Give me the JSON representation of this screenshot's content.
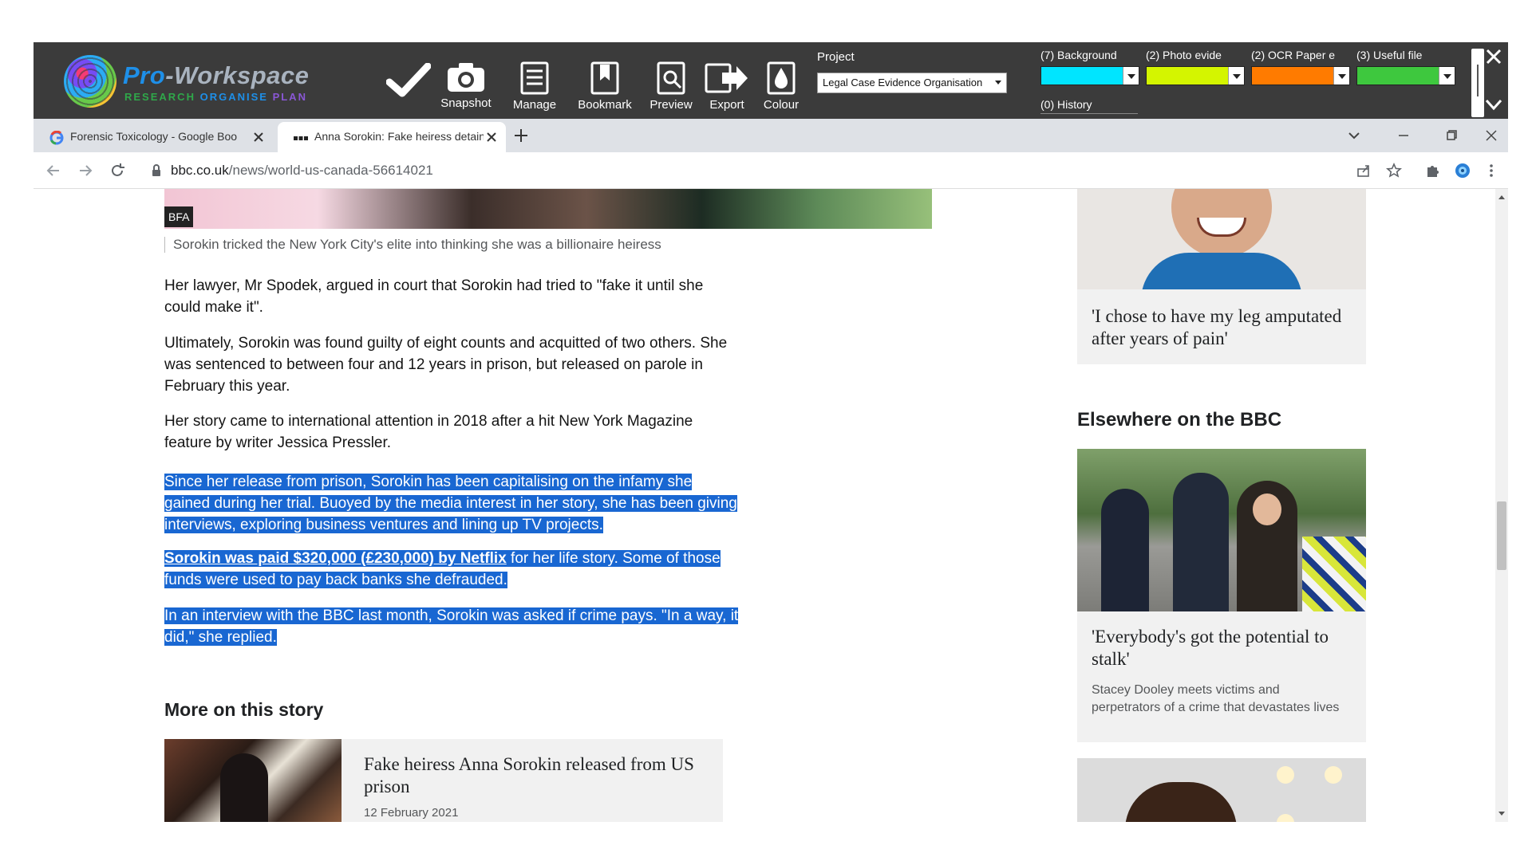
{
  "toolbar": {
    "brand": {
      "name_a": "Pro",
      "name_b": "-Workspace",
      "tag_a": "RESEARCH",
      "tag_b": "ORGANISE",
      "tag_c": "PLAN"
    },
    "buttons": [
      {
        "label": "",
        "icon": "checkmark-icon"
      },
      {
        "label": "Snapshot",
        "icon": "camera-icon"
      },
      {
        "label": "Manage",
        "icon": "document-list-icon"
      },
      {
        "label": "Bookmark",
        "icon": "bookmark-icon"
      },
      {
        "label": "Preview",
        "icon": "preview-icon"
      },
      {
        "label": "Export",
        "icon": "export-icon"
      },
      {
        "label": "Colour",
        "icon": "droplet-icon"
      }
    ],
    "project_label": "Project",
    "project_value": "Legal Case Evidence Organisation",
    "categories": [
      {
        "label": "(7) Background",
        "color": "#00e5ff"
      },
      {
        "label": "(2) Photo evide",
        "color": "#d4f500"
      },
      {
        "label": "(2) OCR Paper e",
        "color": "#ff7b00"
      },
      {
        "label": "(3) Useful file",
        "color": "#3ec83e"
      }
    ],
    "history_label": "(0) History"
  },
  "tabs": [
    {
      "title": "Forensic Toxicology - Google Boo",
      "favicon": "google-icon",
      "active": false
    },
    {
      "title": "Anna Sorokin: Fake heiress detain",
      "favicon": "bbc-icon",
      "active": true
    }
  ],
  "address": {
    "host": "bbc.co.uk",
    "path": "/news/world-us-canada-56614021"
  },
  "article": {
    "badge": "BFA",
    "caption": "Sorokin tricked the New York City's elite into thinking she was a billionaire heiress",
    "paragraphs": [
      "Her lawyer, Mr Spodek, argued in court that Sorokin had tried to \"fake it until she could make it\".",
      "Ultimately, Sorokin was found guilty of eight counts and acquitted of two others. She was sentenced to between four and 12 years in prison, but released on parole in February this year.",
      "Her story came to international attention in 2018 after a hit New York Magazine feature by writer Jessica Pressler."
    ],
    "selected": {
      "p1": "Since her release from prison, Sorokin has been capitalising on the infamy she gained during her trial. Buoyed by the media interest in her story, she has been giving interviews, exploring business ventures and lining up TV projects.",
      "p2_link": "Sorokin was paid $320,000 (£230,000) by Netflix",
      "p2_rest": " for her life story. Some of those funds were used to pay back banks she defrauded.",
      "p3": "In an interview with the BBC last month, Sorokin was asked if crime pays. \"In a way, it did,\" she replied."
    },
    "selection_color": "#1967d2",
    "more_heading": "More on this story",
    "more_card": {
      "title": "Fake heiress Anna Sorokin released from US prison",
      "date": "12 February 2021"
    }
  },
  "sidebar": {
    "card1_title": "'I chose to have my leg amputated after years of pain'",
    "elsewhere_heading": "Elsewhere on the BBC",
    "card2": {
      "title": "'Everybody's got the potential to stalk'",
      "desc": "Stacey Dooley meets victims and perpetrators of a crime that devastates lives"
    }
  }
}
